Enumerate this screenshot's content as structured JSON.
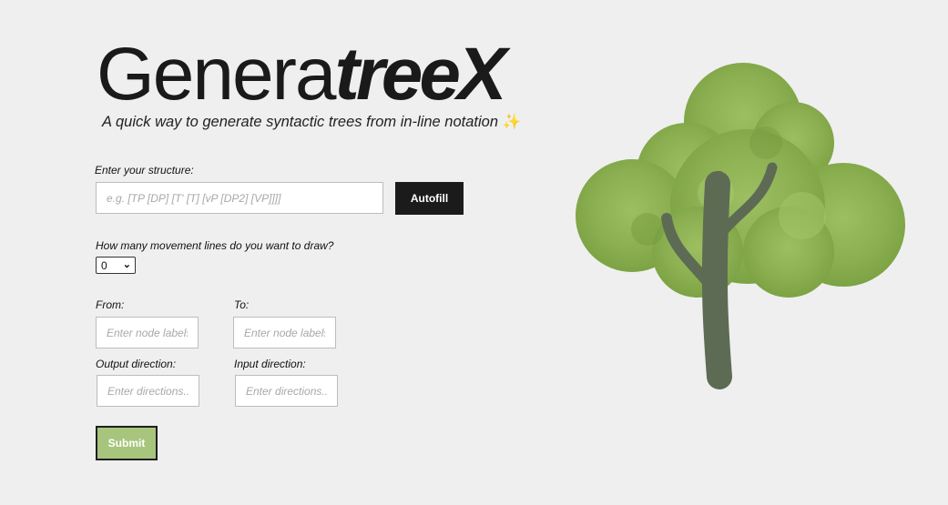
{
  "brand": {
    "title_light": "Genera",
    "title_bold": "treeX"
  },
  "tagline": {
    "text": "A quick way to generate syntactic trees from in-line notation",
    "emoji": "✨"
  },
  "structure": {
    "label": "Enter your structure:",
    "placeholder": "e.g. [TP [DP] [T' [T] [vP [DP2] [VP]]]]",
    "autofill_label": "Autofill"
  },
  "movement": {
    "label": "How many movement lines do you want to draw?",
    "selected": "0",
    "chevron": "⌄"
  },
  "from": {
    "label": "From:",
    "placeholder": "Enter node labels"
  },
  "to": {
    "label": "To:",
    "placeholder": "Enter node labels"
  },
  "output_direction": {
    "label": "Output direction:",
    "placeholder": "Enter directions..."
  },
  "input_direction": {
    "label": "Input direction:",
    "placeholder": "Enter directions..."
  },
  "submit_label": "Submit",
  "illustration": {
    "name": "tree-icon",
    "canopy_color": "#8db152",
    "trunk_color": "#5d6b54"
  },
  "colors": {
    "accent": "#a7c57c",
    "dark_button": "#1b1b1b",
    "background": "#efefef"
  }
}
